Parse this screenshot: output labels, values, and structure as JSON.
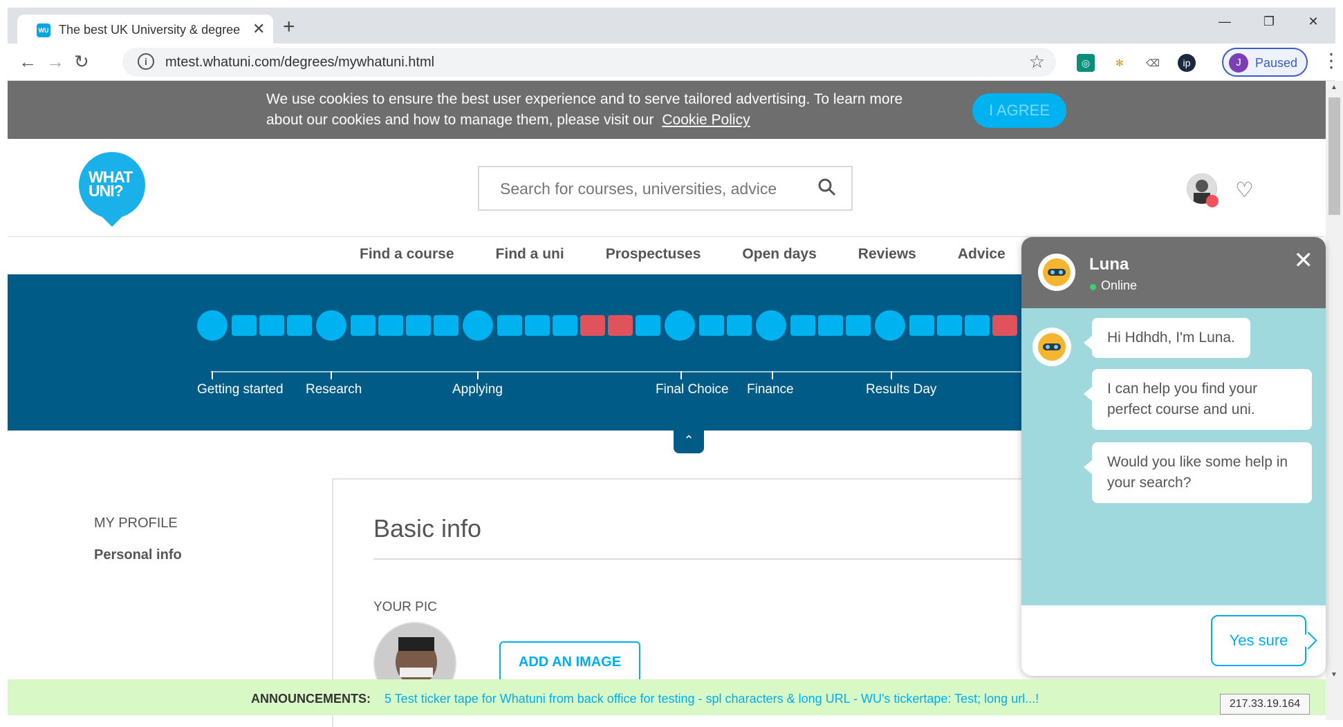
{
  "browser": {
    "tab_title": "The best UK University & degree",
    "tab_favicon": "WU",
    "url": "mtest.whatuni.com/degrees/mywhatuni.html",
    "profile_initial": "J",
    "profile_status": "Paused"
  },
  "cookie": {
    "text": "We use cookies to ensure the best user experience and to serve tailored advertising. To learn more about our cookies and how to manage them, please visit our",
    "link": "Cookie Policy",
    "agree": "I AGREE"
  },
  "header": {
    "logo_line1": "WHAT",
    "logo_line2": "UNI?",
    "search_placeholder": "Search for courses, universities, advice"
  },
  "nav": {
    "items": [
      "Find a course",
      "Find a uni",
      "Prospectuses",
      "Open days",
      "Reviews",
      "Advice"
    ]
  },
  "journey": {
    "stages": [
      "Getting started",
      "Research",
      "Applying",
      "Final Choice",
      "Finance",
      "Results Day"
    ],
    "colors": {
      "done": "#00b3f0",
      "warn": "#e0525c",
      "band": "#005b86"
    }
  },
  "profile": {
    "section": "MY PROFILE",
    "active_item": "Personal info",
    "title": "Basic info",
    "pic_label": "YOUR PIC",
    "add_image": "ADD AN IMAGE"
  },
  "chat": {
    "name": "Luna",
    "status": "Online",
    "messages": [
      "Hi Hdhdh, I'm Luna.",
      "I can help you find your perfect course and uni.",
      "Would you like some help in your search?"
    ],
    "reply": "Yes sure"
  },
  "ticker": {
    "label": "ANNOUNCEMENTS:",
    "text": "5 Test ticker tape for Whatuni from back office for testing - spl characters & long URL - WU's tickertape: Test; long url...!"
  },
  "ip": "217.33.19.164"
}
